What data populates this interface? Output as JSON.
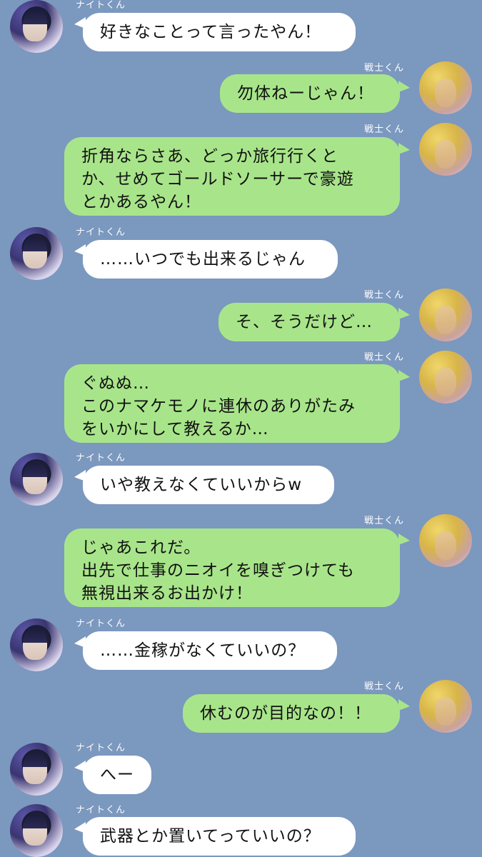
{
  "colors": {
    "background": "#7b98bf",
    "left_bubble": "#ffffff",
    "right_bubble": "#a8e58a",
    "name_text": "#ffffff"
  },
  "contacts": {
    "knight": {
      "name": "ナイトくん",
      "avatar_icon": "knight-avatar-icon"
    },
    "warrior": {
      "name": "戦士くん",
      "avatar_icon": "warrior-avatar-icon"
    }
  },
  "messages": [
    {
      "sender": "ナイトくん",
      "text": "好きなことって言ったやん！"
    },
    {
      "sender": "戦士くん",
      "text": "勿体ねーじゃん！"
    },
    {
      "sender": "戦士くん",
      "text": "折角ならさあ、どっか旅行行くと\nか、せめてゴールドソーサーで豪遊\nとかあるやん！"
    },
    {
      "sender": "ナイトくん",
      "text": "……いつでも出来るじゃん"
    },
    {
      "sender": "戦士くん",
      "text": "そ、そうだけど…"
    },
    {
      "sender": "戦士くん",
      "text": "ぐぬぬ…\nこのナマケモノに連休のありがたみ\nをいかにして教えるか…"
    },
    {
      "sender": "ナイトくん",
      "text": "いや教えなくていいからw"
    },
    {
      "sender": "戦士くん",
      "text": "じゃあこれだ。\n出先で仕事のニオイを嗅ぎつけても\n無視出来るお出かけ！"
    },
    {
      "sender": "ナイトくん",
      "text": "……金稼がなくていいの？"
    },
    {
      "sender": "戦士くん",
      "text": "休むのが目的なの！！"
    },
    {
      "sender": "ナイトくん",
      "text": "へー"
    },
    {
      "sender": "ナイトくん",
      "text": "武器とか置いてっていいの？"
    }
  ]
}
